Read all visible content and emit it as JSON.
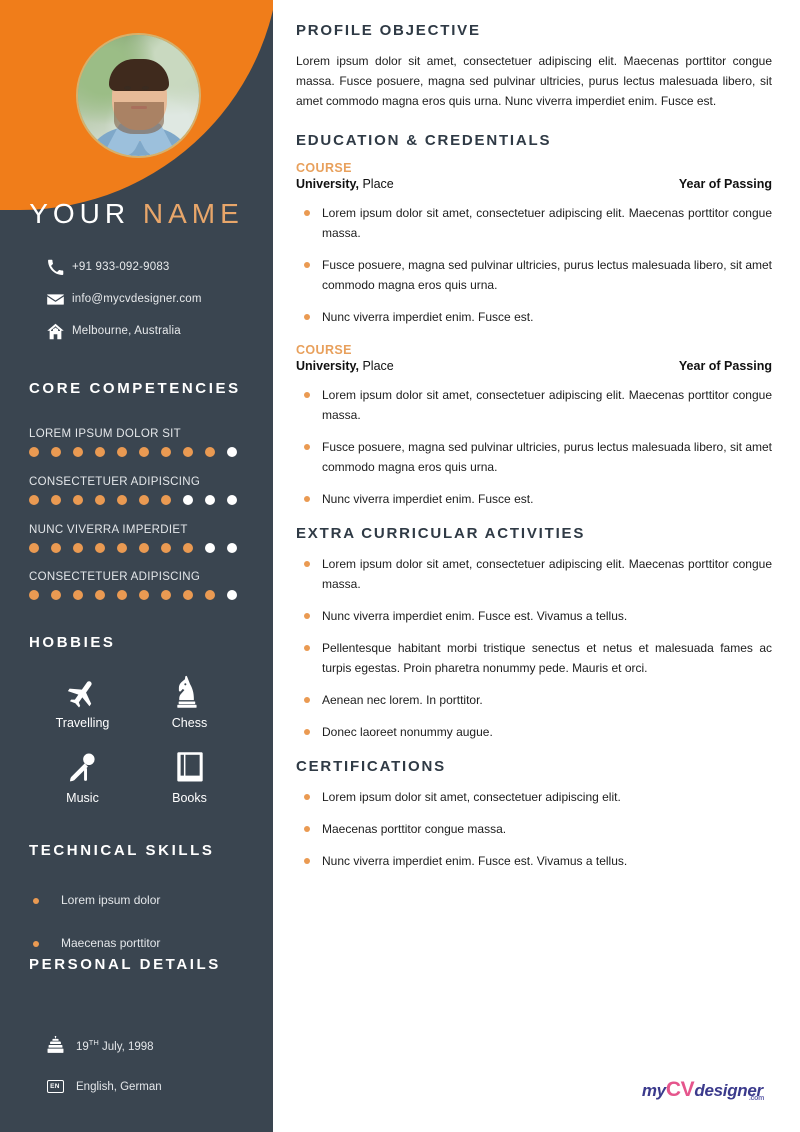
{
  "sidebar": {
    "name_first": "YOUR",
    "name_last": "NAME",
    "contacts": [
      {
        "icon": "phone-icon",
        "value": "+91 933-092-9083"
      },
      {
        "icon": "envelope-icon",
        "value": "info@mycvdesigner.com"
      },
      {
        "icon": "home-icon",
        "value": "Melbourne, Australia"
      }
    ],
    "core_competencies_heading": "CORE COMPETENCIES",
    "competencies": [
      {
        "label": "LOREM IPSUM DOLOR SIT",
        "filled": 9,
        "total": 10
      },
      {
        "label": "CONSECTETUER ADIPISCING",
        "filled": 7,
        "total": 10
      },
      {
        "label": "NUNC VIVERRA IMPERDIET",
        "filled": 8,
        "total": 10
      },
      {
        "label": "CONSECTETUER ADIPISCING",
        "filled": 9,
        "total": 10
      }
    ],
    "hobbies_heading": "HOBBIES",
    "hobbies": [
      {
        "icon": "airplane-icon",
        "label": "Travelling"
      },
      {
        "icon": "chess-knight-icon",
        "label": "Chess"
      },
      {
        "icon": "microphone-icon",
        "label": "Music"
      },
      {
        "icon": "book-icon",
        "label": "Books"
      }
    ],
    "technical_skills_heading": "TECHNICAL SKILLS",
    "technical_skills": [
      "Lorem ipsum dolor",
      "Maecenas porttitor"
    ],
    "personal_details_heading": "PERSONAL DETAILS",
    "personal_details": [
      {
        "icon": "birthday-cake-icon",
        "value_prefix": "19",
        "value_sup": "TH",
        "value_suffix": " July, 1998"
      },
      {
        "icon": "language-badge-icon",
        "badge": "EN",
        "value": "English, German"
      }
    ]
  },
  "main": {
    "profile": {
      "heading": "PROFILE OBJECTIVE",
      "text": "Lorem ipsum dolor sit amet, consectetuer adipiscing elit. Maecenas porttitor congue massa. Fusce posuere, magna sed pulvinar ultricies, purus lectus malesuada libero, sit amet commodo magna eros quis urna. Nunc viverra imperdiet enim. Fusce est."
    },
    "education": {
      "heading": "EDUCATION & CREDENTIALS",
      "entries": [
        {
          "course": "COURSE",
          "university": "University,",
          "place": " Place",
          "year": "Year of Passing",
          "bullets": [
            "Lorem ipsum dolor sit amet, consectetuer adipiscing elit. Maecenas porttitor congue massa.",
            "Fusce posuere, magna sed pulvinar ultricies, purus lectus malesuada libero, sit amet commodo magna eros quis urna.",
            "Nunc viverra imperdiet enim. Fusce est."
          ]
        },
        {
          "course": "COURSE",
          "university": "University,",
          "place": " Place",
          "year": "Year of Passing",
          "bullets": [
            "Lorem ipsum dolor sit amet, consectetuer adipiscing elit. Maecenas porttitor congue massa.",
            "Fusce posuere, magna sed pulvinar ultricies, purus lectus malesuada libero, sit amet commodo magna eros quis urna.",
            "Nunc viverra imperdiet enim. Fusce est."
          ]
        }
      ]
    },
    "extra_curricular": {
      "heading": "EXTRA CURRICULAR ACTIVITIES",
      "bullets": [
        "Lorem ipsum dolor sit amet, consectetuer adipiscing elit. Maecenas porttitor congue massa.",
        "Nunc viverra imperdiet enim. Fusce est. Vivamus a tellus.",
        "Pellentesque habitant morbi tristique senectus et netus et malesuada fames ac turpis egestas. Proin pharetra nonummy pede. Mauris et orci.",
        "Aenean nec lorem. In porttitor.",
        "Donec laoreet nonummy augue."
      ]
    },
    "certifications": {
      "heading": "CERTIFICATIONS",
      "bullets": [
        "Lorem ipsum dolor sit amet, consectetuer adipiscing elit.",
        "Maecenas porttitor congue massa.",
        "Nunc viverra imperdiet enim. Fusce est. Vivamus a tellus."
      ]
    },
    "logo": {
      "part1": "my",
      "part2": "CV",
      "part3": "designer",
      "part4": ".com"
    }
  },
  "colors": {
    "sidebar_bg": "#3a4550",
    "accent_orange": "#f07d1a",
    "dot_orange": "#ea9a52",
    "name_accent": "#e8a66a",
    "heading_dark": "#2f3a45",
    "course_orange": "#e8a05c"
  }
}
